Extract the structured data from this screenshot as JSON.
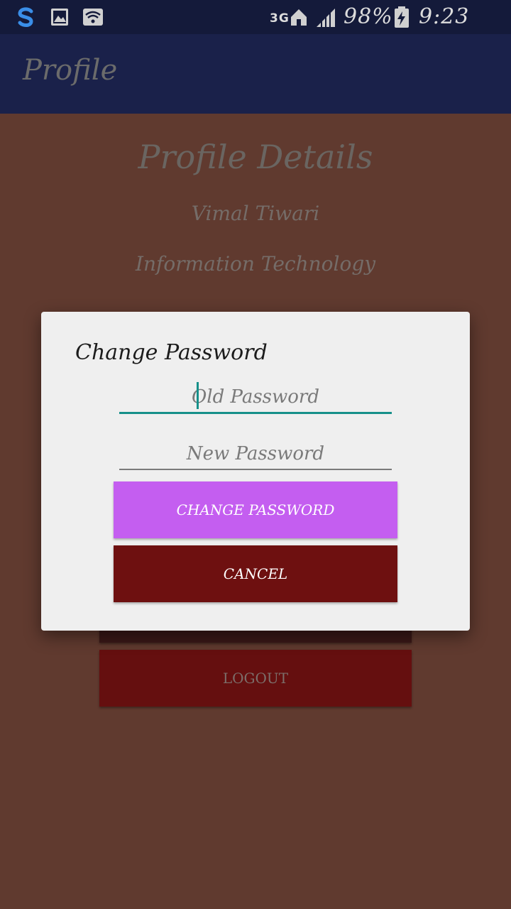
{
  "status_bar": {
    "network": "3G",
    "battery": "98%",
    "time": "9:23 am",
    "icons": [
      "sync-s-icon",
      "gallery-icon",
      "wifi-icon",
      "home-icon",
      "signal-icon",
      "battery-charging-icon"
    ]
  },
  "app_bar": {
    "title": "Profile"
  },
  "profile": {
    "heading": "Profile Details",
    "name": "Vimal Tiwari",
    "department": "Information Technology",
    "logout_label": "LOGOUT"
  },
  "dialog": {
    "title": "Change Password",
    "old_password_placeholder": "Old Password",
    "new_password_placeholder": "New Password",
    "change_button_label": "CHANGE PASSWORD",
    "cancel_button_label": "CANCEL"
  },
  "colors": {
    "status_bar": "#141a3a",
    "app_bar": "#1a214a",
    "background": "#603a2f",
    "dialog": "#efefef",
    "accent_teal": "#16908a",
    "change_button": "#c45ef0",
    "cancel_button": "#6e1010",
    "logout_button": "#650f0f"
  }
}
